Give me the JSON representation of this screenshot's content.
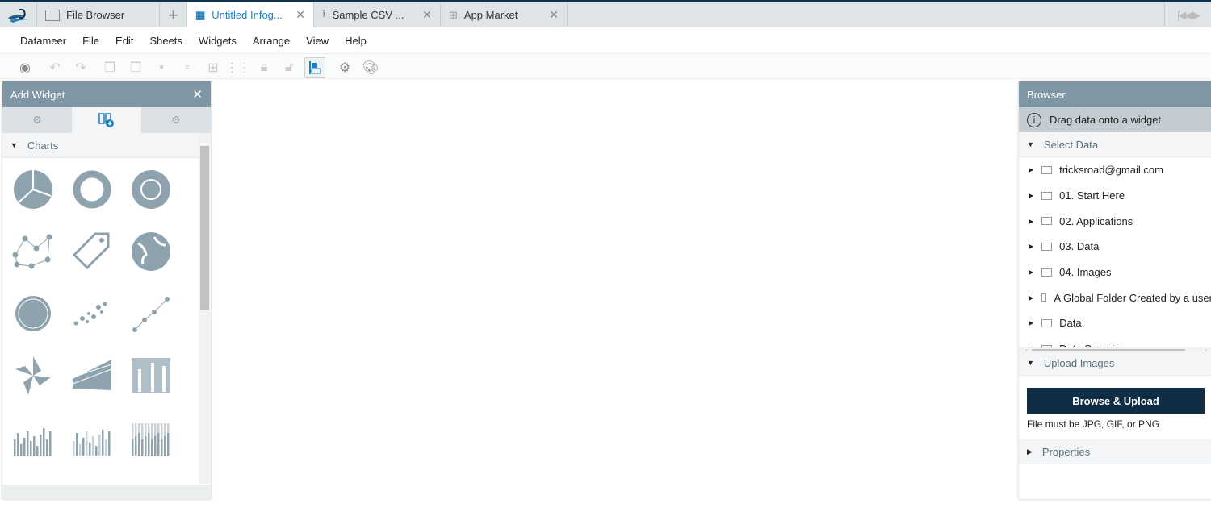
{
  "tabs": [
    {
      "label": "File Browser",
      "icon": "file-browser-icon"
    },
    {
      "label": "Untitled Infog...",
      "icon": "infographic-icon",
      "active": true
    },
    {
      "label": "Sample CSV ...",
      "icon": "upload-icon"
    },
    {
      "label": "App Market",
      "icon": "grid-icon"
    }
  ],
  "menu": [
    "Datameer",
    "File",
    "Edit",
    "Sheets",
    "Widgets",
    "Arrange",
    "View",
    "Help"
  ],
  "add_widget": {
    "title": "Add Widget",
    "section": "Charts",
    "widgets": [
      "pie-chart",
      "donut-chart",
      "sunburst-chart",
      "network-chart",
      "tag-cloud",
      "map-globe",
      "radial-chart",
      "scatter-plot",
      "line-scatter",
      "radar-chart",
      "area-chart",
      "stacked-bar",
      "column-chart",
      "grouped-column",
      "stacked-column"
    ]
  },
  "browser": {
    "title": "Browser",
    "info": "Drag data onto a widget",
    "select_data": "Select Data",
    "items": [
      "tricksroad@gmail.com",
      "01. Start Here",
      "02. Applications",
      "03. Data",
      "04. Images",
      "A Global Folder Created by a user",
      "Data",
      "Data Sample"
    ],
    "upload_images": "Upload Images",
    "upload_button": "Browse & Upload",
    "upload_note": "File must be JPG, GIF, or PNG",
    "properties": "Properties"
  },
  "colors": {
    "accent": "#1f7fc0",
    "header": "#7f97a5",
    "button": "#0f2d45",
    "icon": "#8fa3af"
  }
}
